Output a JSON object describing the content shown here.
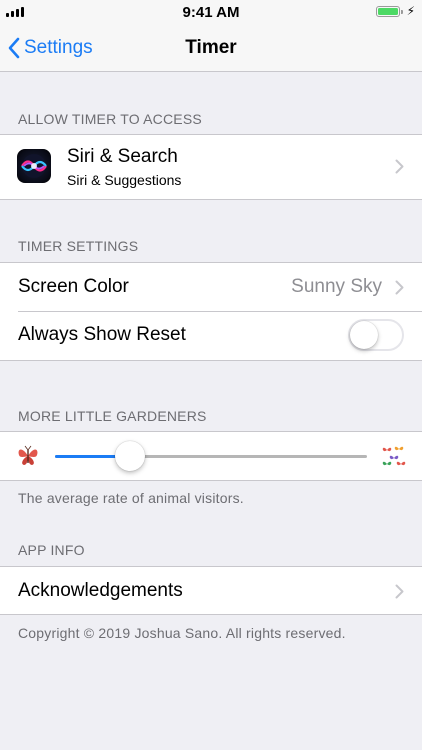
{
  "status_bar": {
    "time": "9:41 AM",
    "battery_color": "#4cd964"
  },
  "nav": {
    "back_label": "Settings",
    "title": "Timer",
    "accent": "#1b7cf5"
  },
  "allow_access": {
    "header": "ALLOW TIMER TO ACCESS",
    "siri": {
      "title": "Siri & Search",
      "subtitle": "Siri & Suggestions",
      "icon": "siri-icon"
    }
  },
  "timer_settings": {
    "header": "TIMER SETTINGS",
    "screen_color": {
      "label": "Screen Color",
      "value": "Sunny Sky"
    },
    "always_show_reset": {
      "label": "Always Show Reset",
      "on": false
    }
  },
  "gardeners": {
    "header": "MORE LITTLE GARDENERS",
    "slider_value": 0.24,
    "min_icon": "butterfly-icon",
    "max_icon": "butterfly-flock-icon",
    "footer": "The average rate of animal visitors."
  },
  "app_info": {
    "header": "APP INFO",
    "acknowledgements": "Acknowledgements",
    "copyright": "Copyright © 2019 Joshua Sano. All rights reserved."
  }
}
